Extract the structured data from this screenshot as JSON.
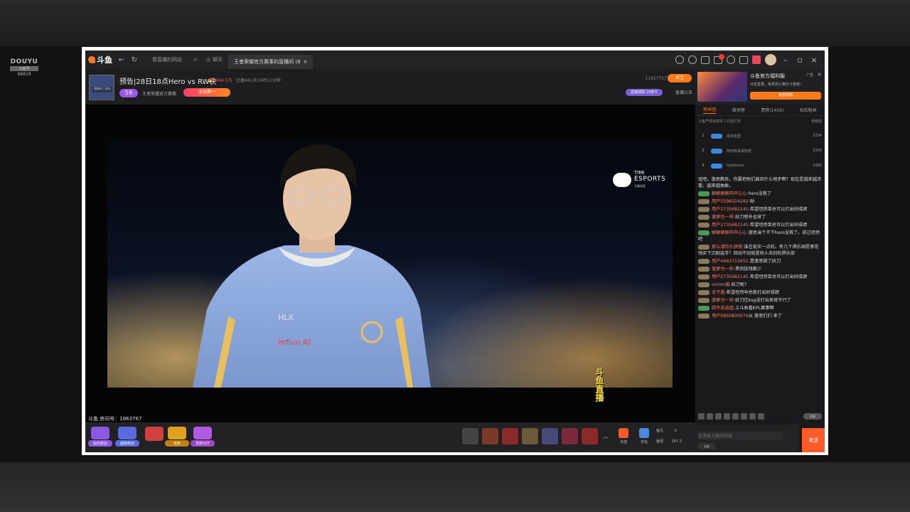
{
  "watermark": {
    "brand": "DOUYU",
    "sub": "斗鱼号",
    "number": "88818"
  },
  "app": {
    "logo_text": "斗鱼",
    "accent": "#ff7a1a"
  },
  "tabs": [
    {
      "label": "看直播的网站"
    },
    {
      "label": "聊天"
    },
    {
      "label": "王者荣耀官方赛事的直播间 (8"
    }
  ],
  "header": {
    "title": "预告|28日18点Hero vs RW侠",
    "heat": "5494.5万",
    "started": "已播461天14时11分钟",
    "level": "59",
    "anchor": "王者荣耀官方赛事",
    "fan_button": "全站第一",
    "follower_count": "11927757",
    "follow_label": "关注",
    "promo_badge": "直播领取 10倍卡",
    "notice_label": "直播公告"
  },
  "room_badge": "直播间 | 排名",
  "video": {
    "room_number_label": "斗鱼 房间号：",
    "room_number": "1863767",
    "timi": {
      "line1": "TIMI",
      "line2": "ESPORTS",
      "line3": "天美电竞"
    },
    "side_logo": "斗鱼直播"
  },
  "bottom_actions": [
    {
      "label": "钻石粉丝",
      "color": "#8a5ae0"
    },
    {
      "label": "超级粉丝",
      "color": "#5a6ae0"
    },
    {
      "label": "",
      "color": "#d04040"
    },
    {
      "label": "任务",
      "color": "#e0a020"
    },
    {
      "label": "贵族大厅",
      "color": "#b05ae0"
    }
  ],
  "bottom_right": {
    "recharge": "充值",
    "backpack": "背包",
    "fish_balls_label": "鱼丸",
    "fish_balls": "0",
    "fish_wings_label": "鱼翅",
    "fish_wings": "167.2"
  },
  "ad": {
    "title": "斗鱼官方福利服",
    "subtitle": "点击登录，免费领火舞办卡鲁酷！",
    "tag": "广告",
    "button": "免费领取"
  },
  "panel_tabs": [
    {
      "label": "粉丝团"
    },
    {
      "label": "周贡榜"
    },
    {
      "label": "贵宾(1416)"
    },
    {
      "label": "钻石粉丝"
    }
  ],
  "rank_header": {
    "left": "斗鱼严禁未成年人充值打赏",
    "right": "贡献值"
  },
  "ranks": [
    {
      "rank": "1",
      "level": "34",
      "name": "喜欢克里",
      "value": "2334"
    },
    {
      "rank": "2",
      "level": "35",
      "name": "阿你啦哥哥阿怒",
      "value": "1939"
    },
    {
      "rank": "3",
      "level": "33",
      "name": "liyilelucas",
      "value": "1995"
    }
  ],
  "chat": [
    {
      "user": "",
      "text": "班吧。菠思教练，你要把他们裁到什么地步啊？现在是越来越凉看，越来越抽象。",
      "badge": ""
    },
    {
      "user": "聊聊聊聊开开心心:",
      "text": "hero没救了",
      "badge": "g"
    },
    {
      "user": "用户5598324282:",
      "text": "呦",
      "badge": ""
    },
    {
      "user": "用户2735682145:",
      "text": "希望坦然单总可以打出好成绩",
      "badge": ""
    },
    {
      "user": "菠萝也一样:",
      "text": "妖刀替补坐穿了",
      "badge": ""
    },
    {
      "user": "用户2735682145:",
      "text": "希望坦然单总可以打出好成绩",
      "badge": ""
    },
    {
      "user": "聊聊聊聊开开心心:",
      "text": "菠思当个不下hero没救了。放过坦然吧",
      "badge": "g"
    },
    {
      "user": "那么请你久拼我:",
      "text": "谁在现实一点的。有几个俱乐部愿意花钱买下沉剧选手？回动不动就是劝人去别的俱乐部",
      "badge": ""
    },
    {
      "user": "用户4463715851:",
      "text": "是菠思毁了妖刀",
      "badge": ""
    },
    {
      "user": "菠萝也一样:",
      "text": "黑肉投钱都少",
      "badge": ""
    },
    {
      "user": "用户2735682145:",
      "text": "希望坦然单总可以打出好成绩",
      "badge": ""
    },
    {
      "user": "omimi酱:",
      "text": "妖刀呢?",
      "badge": ""
    },
    {
      "user": "太不盖:",
      "text": "希望坦然早总能打出好成绩",
      "badge": ""
    },
    {
      "user": "菠萝也一样:",
      "text": "妖刀在ksg没打出来就不行了",
      "badge": ""
    },
    {
      "user": "四不去战虐:",
      "text": "上斗鱼看KPL赛事啊",
      "badge": "g"
    },
    {
      "user": "用户0850830076",
      "text": "从 菠思们们 来了",
      "badge": ""
    }
  ],
  "chat_tools": {
    "pill": "开屏"
  },
  "chat_input": {
    "placeholder": "这里输入聊天内容",
    "hot": "全部"
  },
  "send_label": "发送"
}
